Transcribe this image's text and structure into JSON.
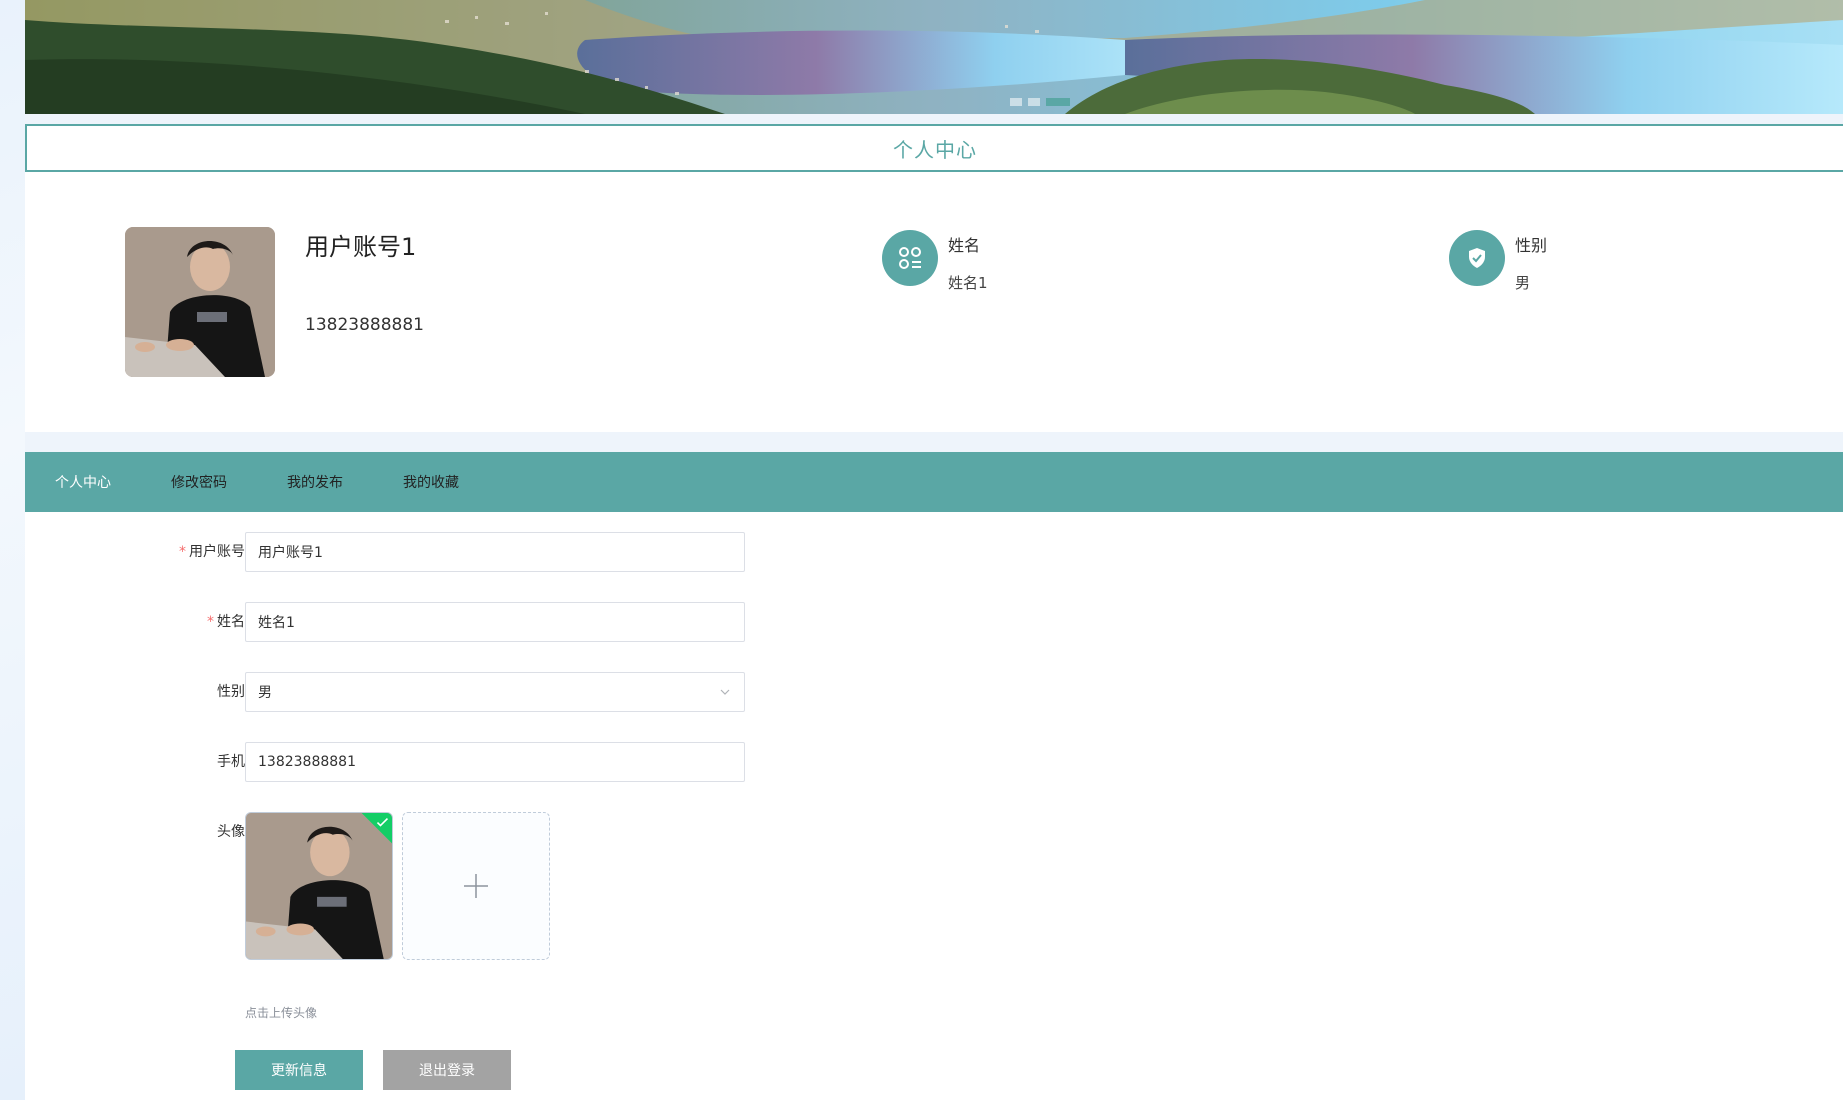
{
  "banner": {
    "slide_count": 3,
    "active_slide": 3
  },
  "title": "个人中心",
  "profile": {
    "username": "用户账号1",
    "phone": "13823888881",
    "name_label": "姓名",
    "name_value": "姓名1",
    "gender_label": "性别",
    "gender_value": "男"
  },
  "tabs": [
    {
      "label": "个人中心",
      "active": true
    },
    {
      "label": "修改密码",
      "active": false
    },
    {
      "label": "我的发布",
      "active": false
    },
    {
      "label": "我的收藏",
      "active": false
    }
  ],
  "form": {
    "account_label": "用户账号",
    "account_value": "用户账号1",
    "name_label": "姓名",
    "name_value": "姓名1",
    "gender_label": "性别",
    "gender_value": "男",
    "phone_label": "手机",
    "phone_value": "13823888881",
    "avatar_label": "头像",
    "upload_hint": "点击上传头像",
    "required_mark": "*"
  },
  "buttons": {
    "update": "更新信息",
    "logout": "退出登录"
  },
  "colors": {
    "accent": "#5aa7a5",
    "required": "#f56c6c",
    "success": "#13ce66",
    "logout_button": "#a3a3a3"
  },
  "icons": {
    "name": "apps-icon",
    "gender": "shield-check-icon",
    "upload": "plus-icon",
    "select": "chevron-down-icon",
    "uploaded": "check-icon"
  }
}
